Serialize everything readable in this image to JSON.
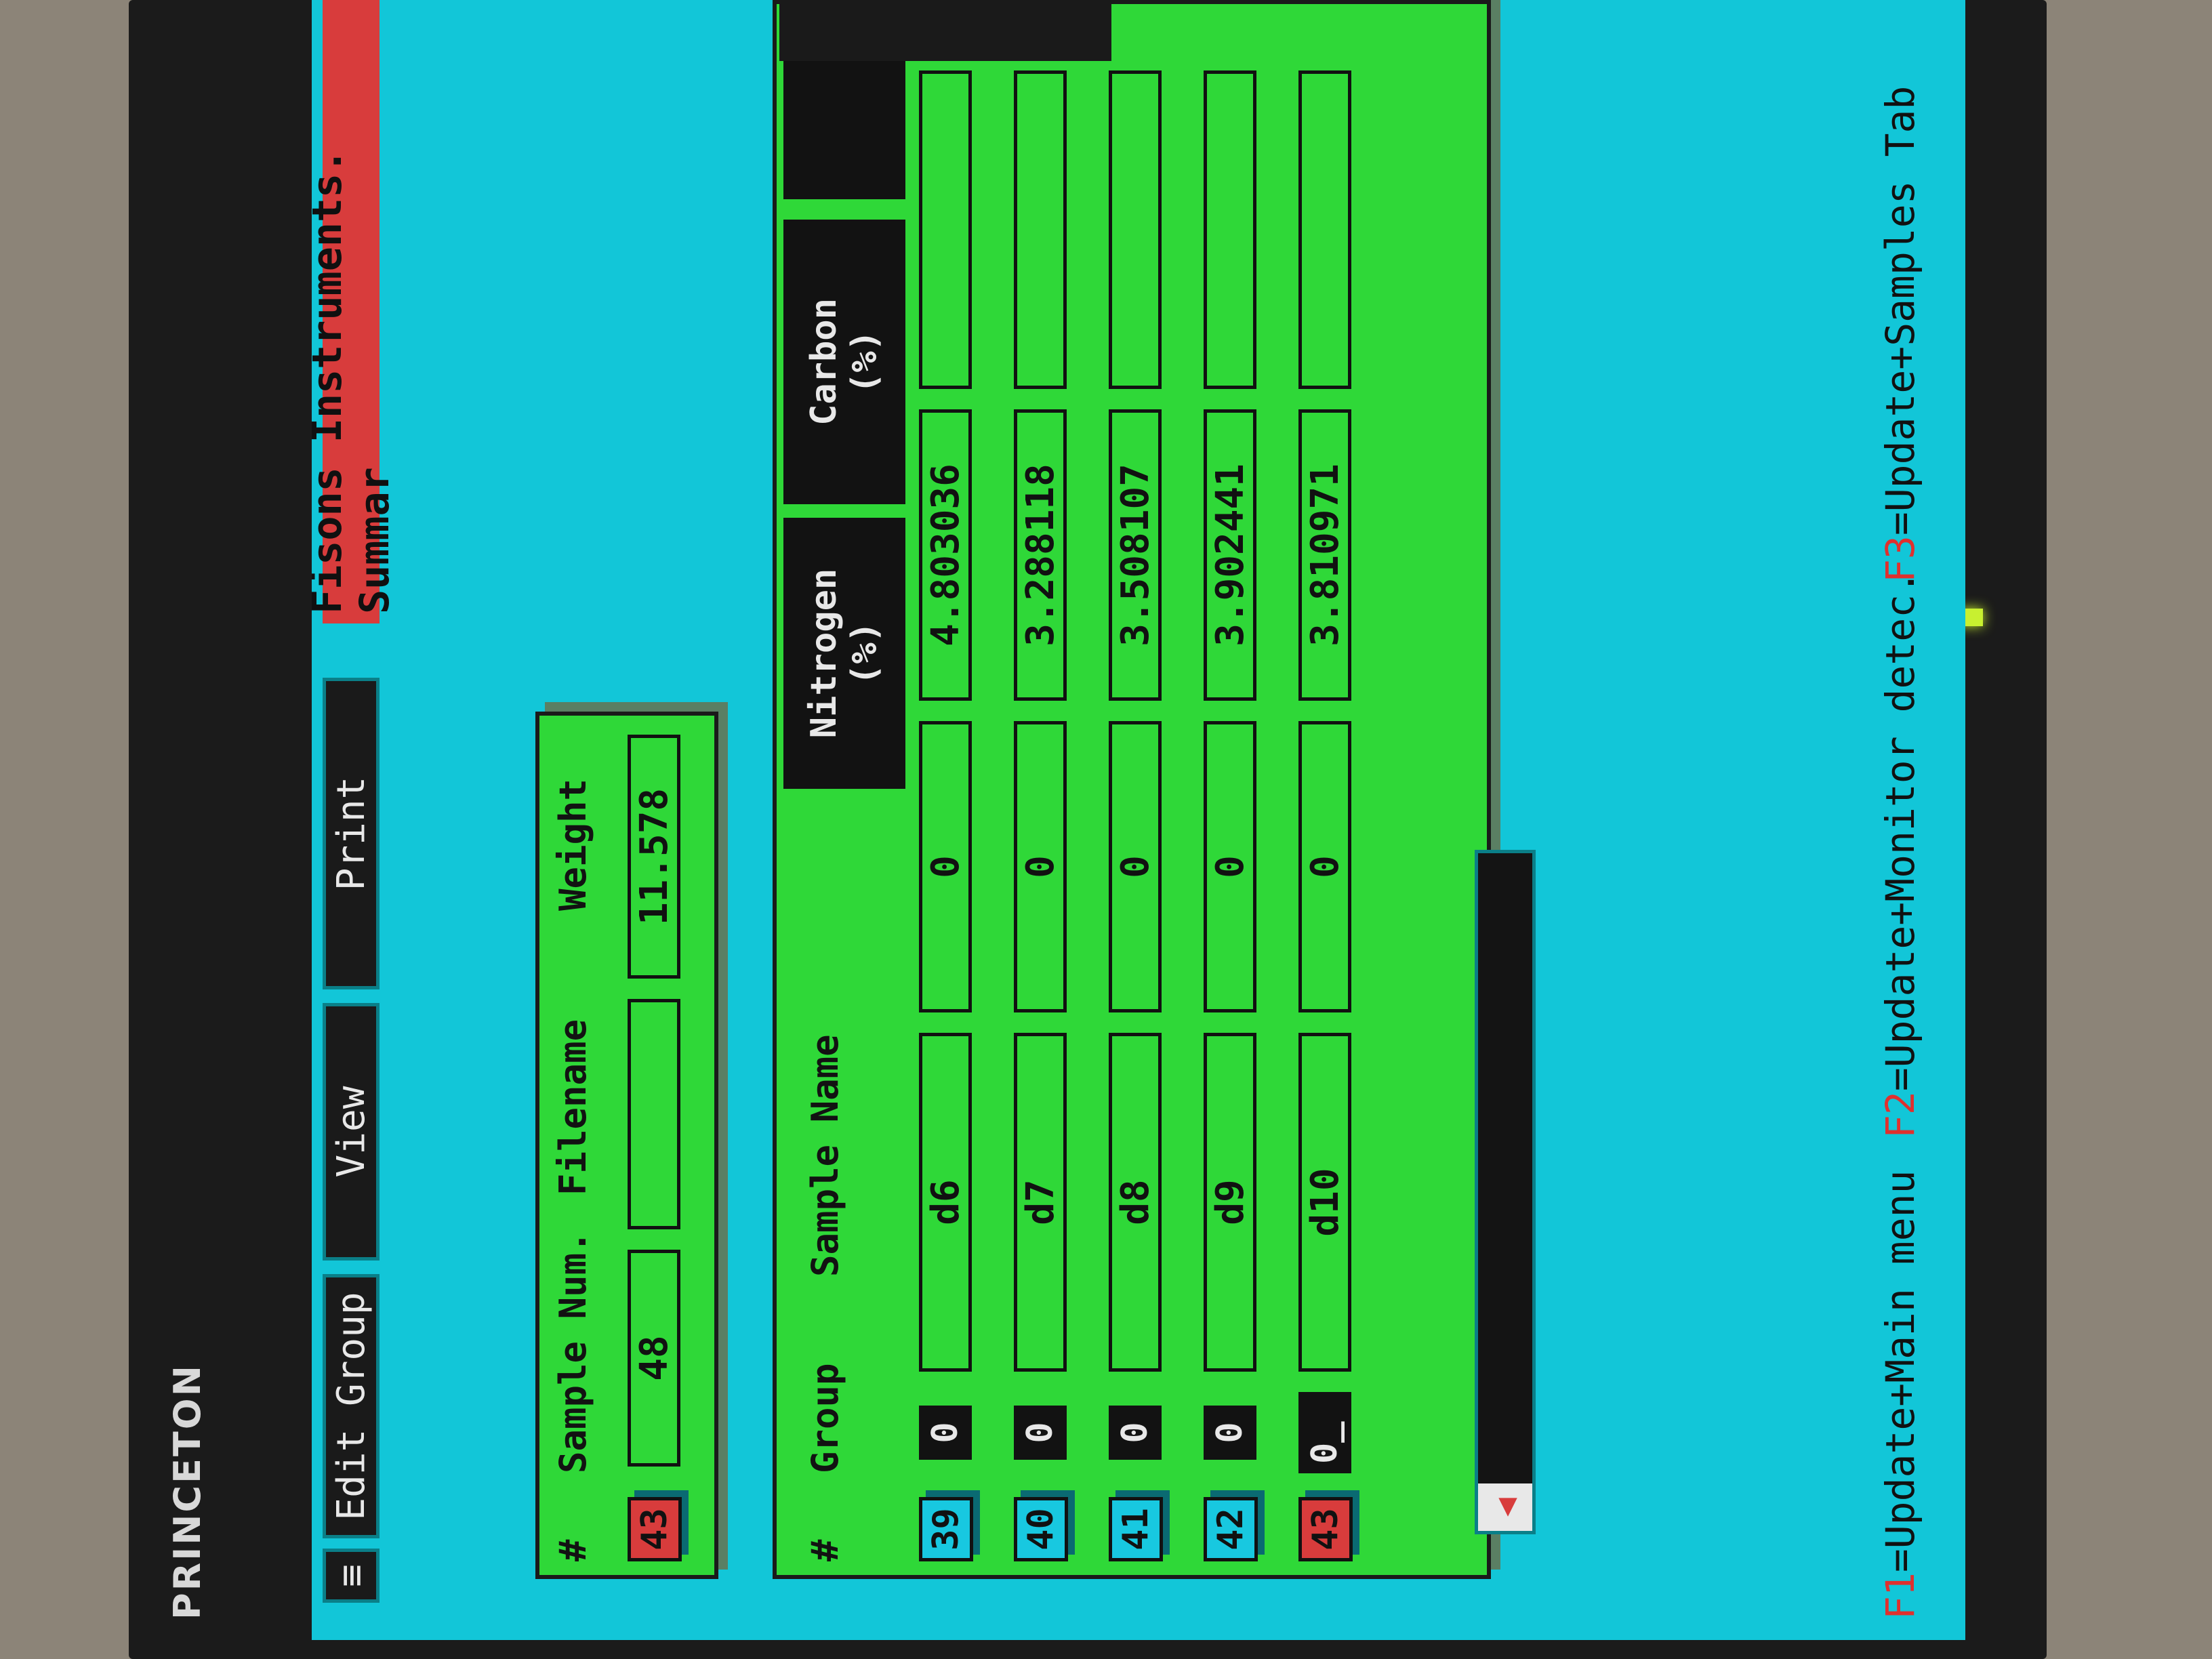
{
  "brand": "PRINCETON",
  "menu": {
    "system_glyph": "≡",
    "items": [
      "Edit Group",
      "View",
      "Print"
    ]
  },
  "title_banner": "Fisons Instruments. Summar",
  "sample_panel": {
    "headers": {
      "hash": "#",
      "sample_num": "Sample Num.",
      "filename": "Filename",
      "weight": "Weight"
    },
    "index": "43",
    "sample_num": "48",
    "filename": "",
    "weight": "11.578"
  },
  "table": {
    "headers": {
      "hash": "#",
      "group": "Group",
      "sample_name": "Sample Name",
      "nitrogen": "Nitrogen",
      "nitrogen_unit": "(%)",
      "carbon": "Carbon",
      "carbon_unit": "(%)"
    },
    "rows": [
      {
        "index": "39",
        "group": "0",
        "sample_name": "d6",
        "nitrogen": "0",
        "carbon": "4.803036"
      },
      {
        "index": "40",
        "group": "0",
        "sample_name": "d7",
        "nitrogen": "0",
        "carbon": "3.288118"
      },
      {
        "index": "41",
        "group": "0",
        "sample_name": "d8",
        "nitrogen": "0",
        "carbon": "3.508107"
      },
      {
        "index": "42",
        "group": "0",
        "sample_name": "d9",
        "nitrogen": "0",
        "carbon": "3.902441"
      },
      {
        "index": "43",
        "group": "0_",
        "sample_name": "d10",
        "nitrogen": "0",
        "carbon": "3.810971"
      }
    ]
  },
  "status_bar": {
    "f1_key": "F1",
    "f1_text": "=Update+Main menu",
    "f2_key": "F2",
    "f2_text": "=Update+Monitor detec.",
    "f3_key": "F3",
    "f3_text": "=Update+Samples Tab"
  },
  "colors": {
    "screen_bg": "#12c6d8",
    "panel": "#2fd838",
    "accent_red": "#d83c3c",
    "index_cyan": "#18c8e0"
  }
}
